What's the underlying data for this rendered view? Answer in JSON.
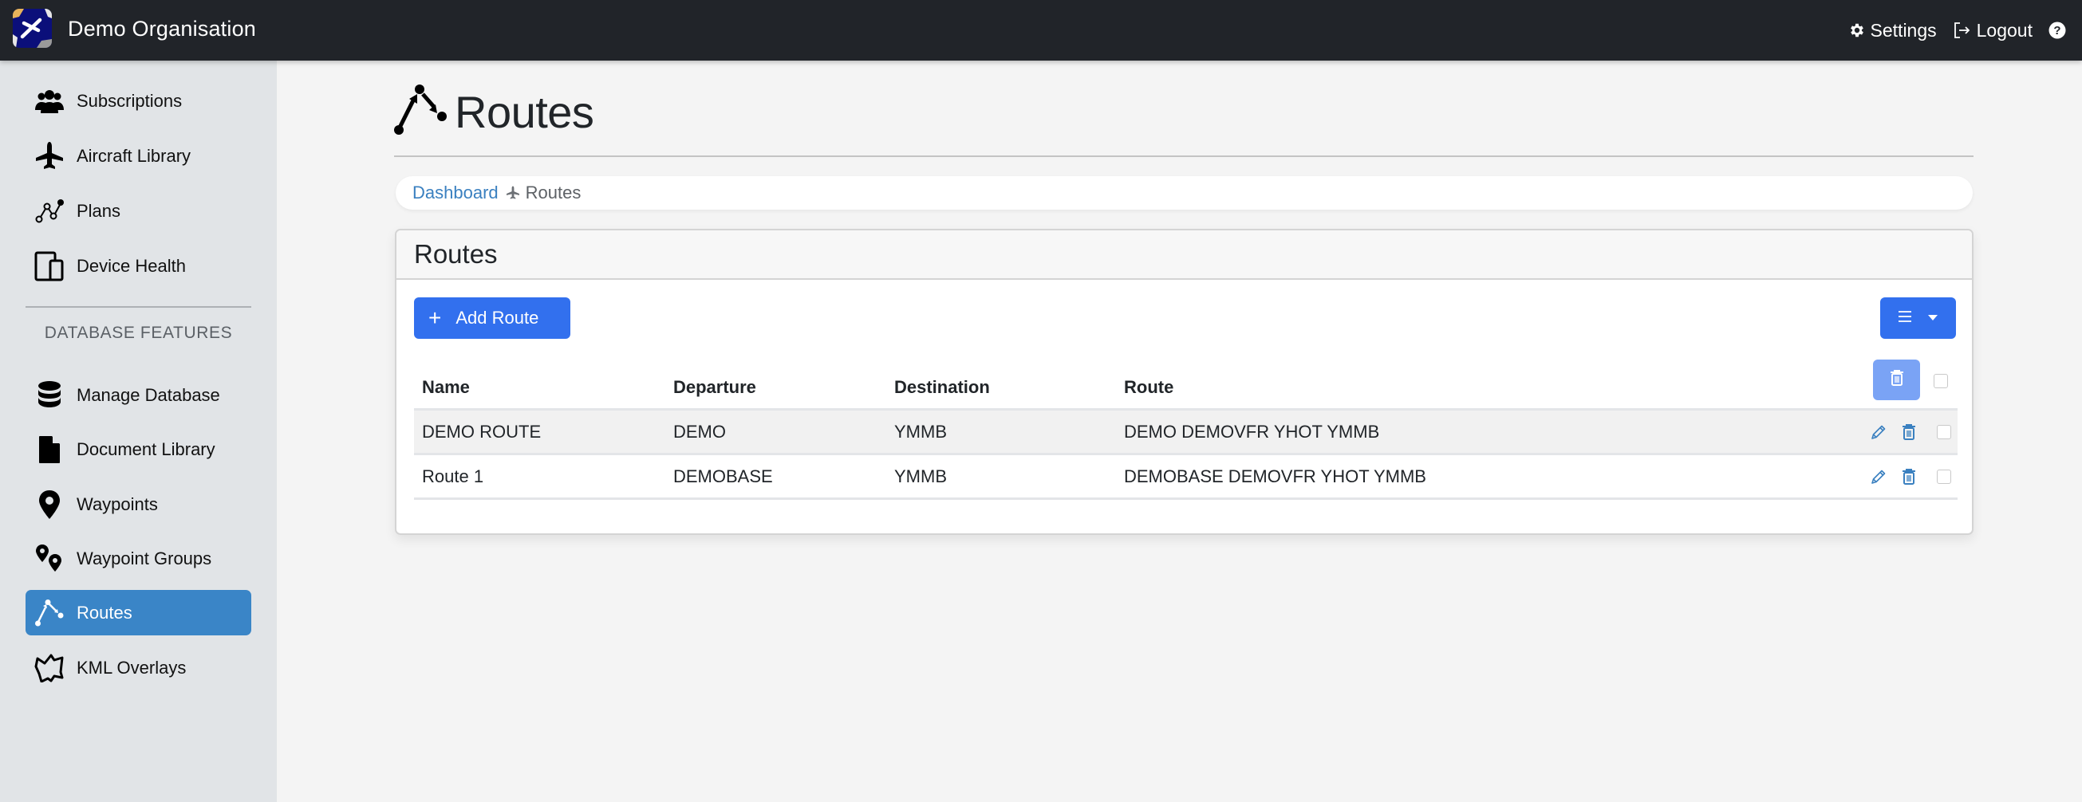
{
  "navbar": {
    "org_name": "Demo Organisation",
    "logo_icon": "organisation-logo",
    "links": [
      {
        "label": "Settings",
        "icon": "gear-icon"
      },
      {
        "label": "Logout",
        "icon": "logout-icon"
      }
    ],
    "help_icon": "help-icon"
  },
  "sidebar": {
    "items": [
      {
        "label": "Subscriptions",
        "icon": "users-icon"
      },
      {
        "label": "Aircraft Library",
        "icon": "plane-icon"
      },
      {
        "label": "Plans",
        "icon": "plans-icon"
      },
      {
        "label": "Device Health",
        "icon": "devices-icon"
      }
    ],
    "section_heading": "DATABASE FEATURES",
    "db_items": [
      {
        "label": "Manage Database",
        "icon": "database-icon"
      },
      {
        "label": "Document Library",
        "icon": "file-icon"
      },
      {
        "label": "Waypoints",
        "icon": "map-marker-icon"
      },
      {
        "label": "Waypoint Groups",
        "icon": "map-markers-icon"
      },
      {
        "label": "Routes",
        "icon": "route-icon",
        "active": true
      },
      {
        "label": "KML Overlays",
        "icon": "kml-overlay-icon"
      }
    ]
  },
  "page": {
    "title": "Routes",
    "breadcrumb": {
      "link": "Dashboard",
      "separator_icon": "plane-icon",
      "current": "Routes"
    }
  },
  "card": {
    "title": "Routes",
    "add_button": {
      "label": "Add Route",
      "icon": "plus-icon"
    },
    "columns_button": {
      "icon": "list-icon",
      "caret": "caret-down-icon"
    },
    "bulk_delete_icon": "trash-icon",
    "table": {
      "headers": [
        "Name",
        "Departure",
        "Destination",
        "Route"
      ],
      "rows": [
        {
          "name": "DEMO ROUTE",
          "departure": "DEMO",
          "destination": "YMMB",
          "route": "DEMO DEMOVFR YHOT YMMB",
          "checked": false
        },
        {
          "name": "Route 1",
          "departure": "DEMOBASE",
          "destination": "YMMB",
          "route": "DEMOBASE DEMOVFR YHOT YMMB",
          "checked": false
        }
      ]
    }
  },
  "colors": {
    "navbar_bg": "#212429",
    "sidebar_bg": "#e1e4e7",
    "active_item": "#3a85c7",
    "primary_button": "#3270ee",
    "disabled_button": "#7aa3f5",
    "link": "#3a80c0",
    "action_icon": "#3a80c0"
  }
}
